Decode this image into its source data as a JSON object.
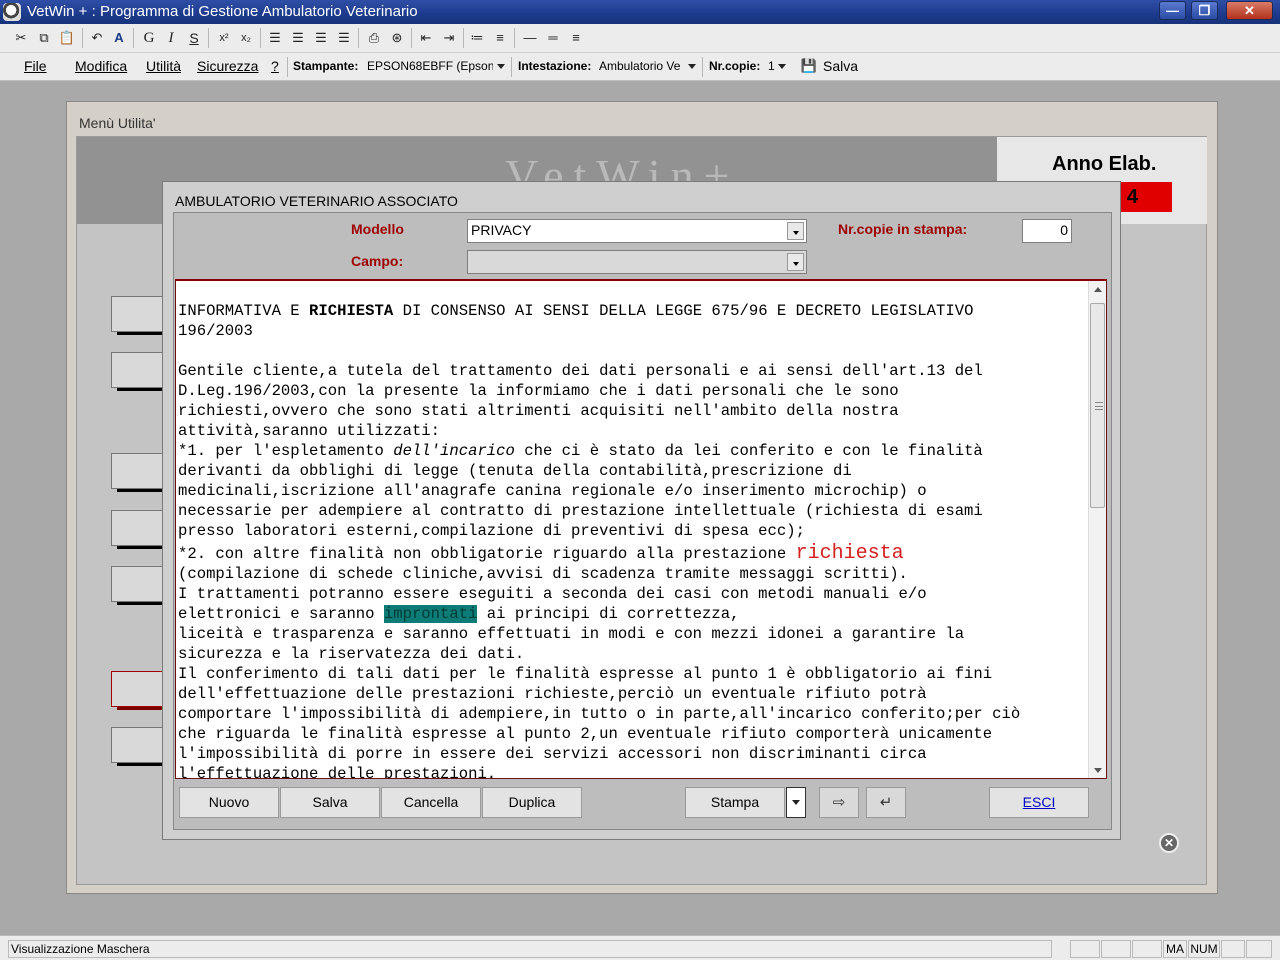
{
  "window": {
    "title": "VetWin + : Programma di Gestione Ambulatorio Veterinario",
    "minimize": "—",
    "maximize": "❐",
    "close": "✕"
  },
  "toolbar": {
    "icons": [
      "cut-icon",
      "copy-icon",
      "paste-icon",
      "undo-icon",
      "font-color-icon",
      "bold-icon",
      "italic-icon",
      "underline-icon",
      "superscript-icon",
      "subscript-icon",
      "align-left-icon",
      "align-center-icon",
      "align-right-icon",
      "justify-icon",
      "print-icon",
      "preview-icon",
      "outdent-icon",
      "indent-icon",
      "numbered-list-icon",
      "bullet-list-icon",
      "line-single-icon",
      "line-double-icon",
      "line-triple-icon"
    ],
    "bold": "G",
    "italic": "I",
    "underline": "S"
  },
  "menubar": {
    "file": "File",
    "modifica": "Modifica",
    "utilita": "Utilità",
    "sicurezza": "Sicurezza",
    "help": "?",
    "stampante_label": "Stampante:",
    "stampante_value": "EPSON68EBFF (Epson",
    "intestazione_label": "Intestazione:",
    "intestazione_value": "Ambulatorio Ve",
    "nrcopie_label": "Nr.copie:",
    "nrcopie_value": "1",
    "salva": "Salva"
  },
  "menu_window": {
    "title": "Menù Utilita'",
    "logo": "VetWin+",
    "anno_label": "Anno Elab.",
    "anno_value": "4"
  },
  "dialog": {
    "title": "AMBULATORIO VETERINARIO ASSOCIATO",
    "modello_label": "Modello",
    "modello_value": "PRIVACY",
    "campo_label": "Campo:",
    "campo_value": "",
    "nrcopie_label": "Nr.copie in stampa:",
    "nrcopie_value": "0",
    "buttons": {
      "nuovo": "Nuovo",
      "salva": "Salva",
      "cancella": "Cancella",
      "duplica": "Duplica",
      "stampa": "Stampa",
      "esci": "ESCI"
    }
  },
  "document": {
    "l1a": "INFORMATIVA E ",
    "l1b": "RICHIESTA",
    "l1c": " DI CONSENSO AI SENSI DELLA LEGGE 675/96 E DECRETO LEGISLATIVO",
    "l2": "196/2003",
    "l3": "Gentile cliente,a tutela del trattamento dei dati personali e ai sensi dell'art.13 del",
    "l4": "D.Leg.196/2003,con la presente la informiamo che i dati personali che le sono",
    "l5": "richiesti,ovvero che sono stati altrimenti acquisiti nell'ambito della nostra",
    "l6": "attività,saranno utilizzati:",
    "l7a": "*1. per l'espletamento ",
    "l7b": "dell'incarico",
    "l7c": " che ci è stato da lei conferito e con le finalità",
    "l8": "derivanti da obblighi di legge (tenuta della contabilità,prescrizione di",
    "l9": "medicinali,iscrizione all'anagrafe canina regionale e/o inserimento microchip) o",
    "l10": "necessarie per adempiere al contratto di prestazione intellettuale (richiesta di esami",
    "l11": "presso laboratori esterni,compilazione di preventivi di spesa ecc);",
    "l12a": "*2. con altre finalità non obbligatorie riguardo alla prestazione ",
    "l12b": "richiesta",
    "l13": "(compilazione di schede cliniche,avvisi di scadenza tramite messaggi scritti).",
    "l14": "I trattamenti potranno essere eseguiti a seconda dei casi con metodi manuali e/o",
    "l15a": "elettronici e saranno ",
    "l15b": "improntati",
    "l15c": " ai principi di correttezza,",
    "l16": "liceità e trasparenza e saranno effettuati in modi e con mezzi idonei a garantire la",
    "l17": "sicurezza e la riservatezza dei dati.",
    "l18": "Il conferimento di tali dati per le finalità espresse al punto 1 è obbligatorio ai fini",
    "l19": "dell'effettuazione delle prestazioni richieste,perciò un eventuale rifiuto potrà",
    "l20": "comportare l'impossibilità di adempiere,in tutto o in parte,all'incarico conferito;per ciò",
    "l21": "che riguarda le finalità espresse al punto 2,un eventuale rifiuto comporterà unicamente",
    "l22": "l'impossibilità di porre in essere dei servizi accessori non discriminanti circa",
    "l23": "l'effettuazione delle prestazioni."
  },
  "statusbar": {
    "text": "Visualizzazione Maschera",
    "ma": "MA",
    "num": "NUM"
  }
}
